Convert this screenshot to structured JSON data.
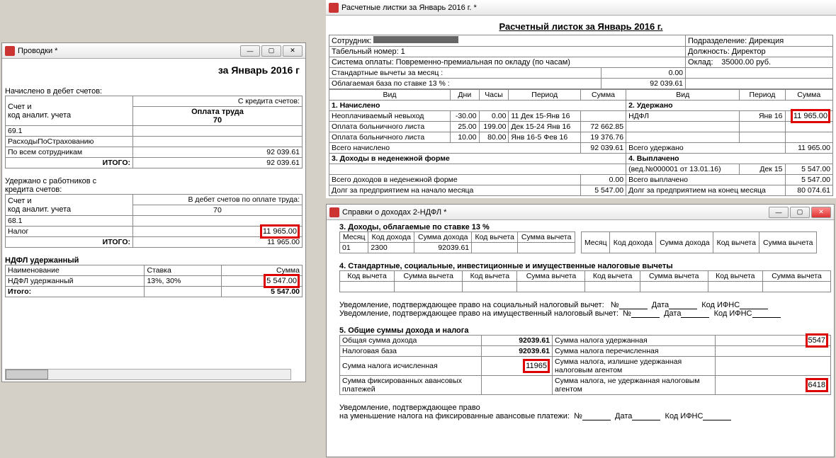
{
  "win1": {
    "title": "Проводки *",
    "heading": "за Январь 2016 г",
    "sec1": "Начислено в дебет счетов:",
    "fromCredit": "С кредита счетов:",
    "acc_hdr1": "Счет и",
    "acc_hdr2": "код аналит. учета",
    "col_pay": "Оплата труда",
    "col_pay_code": "70",
    "r1_acc": "69.1",
    "r2_acc": "РасходыПоСтрахованию",
    "r3_acc": "По всем сотрудникам",
    "r3_val": "92 039.61",
    "itogo": "ИТОГО:",
    "itogo1_val": "92 039.61",
    "sec2a": "Удержано с работников с",
    "sec2b": "кредита счетов:",
    "toDebit": "В дебет счетов по оплате труда:",
    "r4_acc": "68.1",
    "r5_acc": "Налог",
    "r5_val": "11 965.00",
    "itogo2_val": "11 965.00",
    "sec3": "НДФЛ удержанный",
    "h_name": "Наименование",
    "h_rate": "Ставка",
    "h_sum": "Сумма",
    "r6_name": "НДФЛ удержанный",
    "r6_rate": "13%, 30%",
    "r6_val": "5 547.00",
    "itogo3": "Итого:",
    "itogo3_val": "5 547.00"
  },
  "win2": {
    "title": "Расчетные листки за Январь 2016 г. *",
    "doc_title": "Расчетный листок за Январь 2016 г.",
    "emp": "Сотрудник:",
    "div": "Подразделение:",
    "div_v": "Дирекция",
    "tab": "Табельный номер:",
    "tab_v": "1",
    "pos": "Должность:",
    "pos_v": "Директор",
    "paysys": "Система оплаты:",
    "paysys_v": "Повременно-премиальная по окладу (по часам)",
    "salary": "Оклад:",
    "salary_v": "35000.00 руб.",
    "stdded": "Стандартные вычеты за месяц :",
    "stdded_v": "0.00",
    "base": "Облагаемая база по ставке 13 % :",
    "base_v": "92 039.61",
    "c_vid": "Вид",
    "c_dni": "Дни",
    "c_chasy": "Часы",
    "c_period": "Период",
    "c_sum": "Сумма",
    "s1": "1. Начислено",
    "s2": "2. Удержано",
    "r1": {
      "vid": "Неоплачиваемый невыход",
      "dni": "-30.00",
      "chasy": "0.00",
      "per": "11 Дек 15-Янв 16",
      "sum": ""
    },
    "r1b": {
      "vid": "НДФЛ",
      "per": "Янв 16",
      "sum": "11 965.00"
    },
    "r2": {
      "vid": "Оплата больничного листа",
      "dni": "25.00",
      "chasy": "199.00",
      "per": "Дек 15-24 Янв 16",
      "sum": "72 662.85"
    },
    "r3": {
      "vid": "Оплата больничного листа",
      "dni": "10.00",
      "chasy": "80.00",
      "per": "Янв 16-5 Фев 16",
      "sum": "19 376.76"
    },
    "tot_nach": "Всего начислено",
    "tot_nach_v": "92 039.61",
    "tot_ud": "Всего удержано",
    "tot_ud_v": "11 965.00",
    "s3": "3. Доходы в неденежной форме",
    "s4": "4. Выплачено",
    "r4": {
      "vid": "(вед.№000001 от 13.01.16)",
      "per": "Дек 15",
      "sum": "5 547.00"
    },
    "tot3": "Всего доходов в неденежной форме",
    "tot3_v": "0.00",
    "tot4": "Всего выплачено",
    "tot4_v": "5 547.00",
    "debt_start": "Долг за предприятием на начало месяца",
    "debt_start_v": "5 547.00",
    "debt_end": "Долг за предприятием  на конец месяца",
    "debt_end_v": "80 074.61"
  },
  "win3": {
    "title": "Справки о доходах 2-НДФЛ *",
    "s3": "3. Доходы, облагаемые по ставке     13    %",
    "h_month": "Месяц",
    "h_kodd": "Код дохода",
    "h_sumd": "Сумма дохода",
    "h_kodv": "Код вычета",
    "h_sumv": "Сумма вычета",
    "row": {
      "m": "01",
      "kd": "2300",
      "sd": "92039.61"
    },
    "s4": "4. Стандартные, социальные, инвестиционные и имущественные налоговые вычеты",
    "not1": "Уведомление, подтверждающее право на социальный налоговый вычет:",
    "not2": "Уведомление, подтверждающее право на имущественный налоговый вычет:",
    "no": "№",
    "date": "Дата",
    "ifns": "Код ИФНС",
    "s5": "5. Общие суммы дохода и налога",
    "r5a": {
      "l": "Общая сумма дохода",
      "v": "92039.61",
      "r": "Сумма налога удержанная",
      "rv": "5547"
    },
    "r5b": {
      "l": "Налоговая база",
      "v": "92039.61",
      "r": "Сумма налога перечисленная",
      "rv": ""
    },
    "r5c": {
      "l": "Сумма налога исчисленная",
      "v": "11965",
      "r": "Сумма налога, излишне удержанная налоговым агентом",
      "rv": ""
    },
    "r5d": {
      "l": "Сумма фиксированных авансовых платежей",
      "v": "",
      "r": "Сумма налога, не удержанная налоговым агентом",
      "rv": "6418"
    },
    "not3a": "Уведомление, подтверждающее право",
    "not3b": "на уменьшение налога на фиксированные авансовые платежи:"
  }
}
